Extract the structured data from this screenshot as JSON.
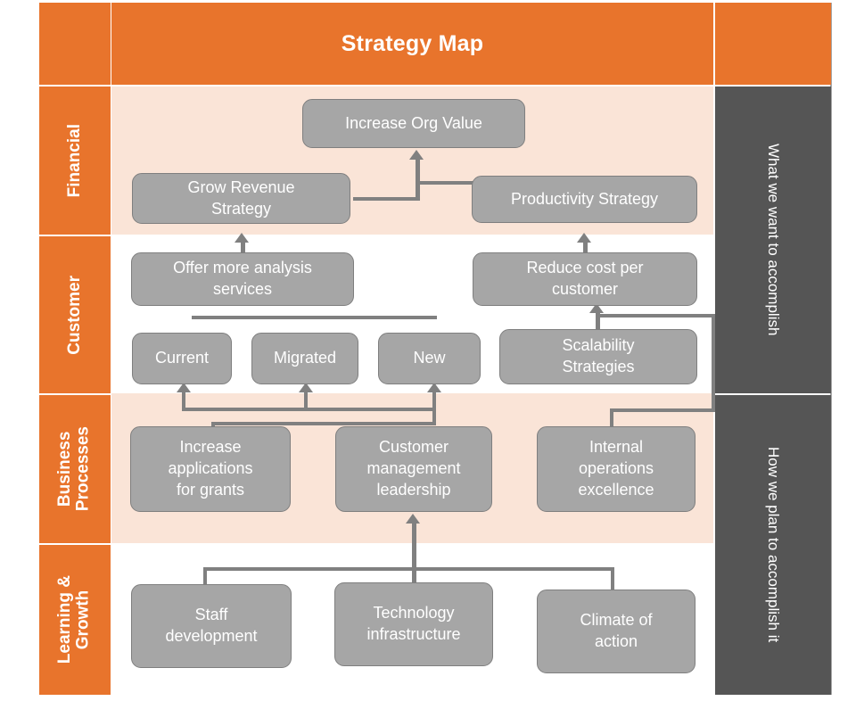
{
  "title": "Strategy Map",
  "colors": {
    "orange": "#E8742C",
    "band_peach": "#FAE4D7",
    "band_white": "#FFFFFF",
    "node_fill": "#A6A6A6",
    "node_border": "#7F7F7F",
    "panel_dark": "#555555",
    "connector": "#808080",
    "text_light": "#FFFFFF"
  },
  "perspectives": [
    {
      "label": "Financial"
    },
    {
      "label": "Customer"
    },
    {
      "label": "Business\nProcesses"
    },
    {
      "label": "Learning &\nGrowth"
    }
  ],
  "right_panel": [
    {
      "label": "What we want to accomplish"
    },
    {
      "label": "How we plan to  accomplish it"
    }
  ],
  "nodes": {
    "increase_org_value": "Increase Org Value",
    "grow_revenue_strategy": "Grow Revenue\nStrategy",
    "productivity_strategy": "Productivity Strategy",
    "offer_more_analysis_services": "Offer more analysis\nservices",
    "reduce_cost_per_customer": "Reduce cost per\ncustomer",
    "current": "Current",
    "migrated": "Migrated",
    "new": "New",
    "scalability_strategies": "Scalability\nStrategies",
    "increase_applications_for_grants": "Increase\napplications\nfor grants",
    "customer_management_leadership": "Customer\nmanagement\nleadership",
    "internal_operations_excellence": "Internal\noperations\nexcellence",
    "staff_development": "Staff\ndevelopment",
    "technology_infrastructure": "Technology\ninfrastructure",
    "climate_of_action": "Climate of\naction"
  }
}
